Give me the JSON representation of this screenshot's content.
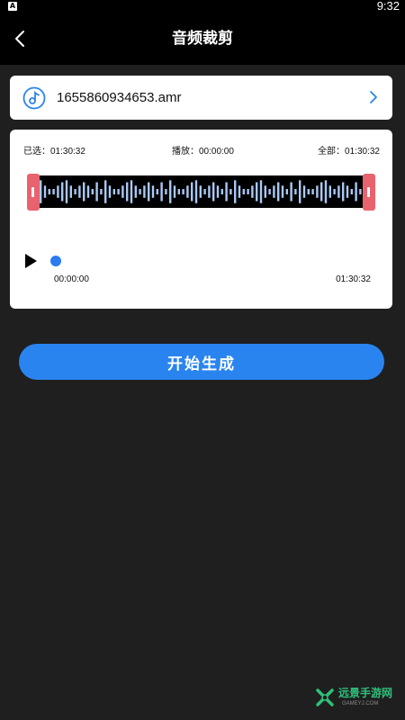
{
  "status_bar": {
    "badge": "A",
    "time": "9:32"
  },
  "app_bar": {
    "title": "音频裁剪",
    "back_icon": "back-arrow-icon"
  },
  "file": {
    "name": "1655860934653.amr",
    "icon": "music-note-icon",
    "chevron_icon": "chevron-right-icon"
  },
  "editor": {
    "selected": "已选：01:30:32",
    "playing": "播放：00:00:00",
    "total": "全部：01:30:32",
    "time_start": "00:00:00",
    "time_end": "01:30:32",
    "playback_progress": 0
  },
  "actions": {
    "generate_label": "开始生成"
  },
  "watermark": {
    "brand": "远景手游网",
    "sub": "GAMEYJ.COM"
  },
  "colors": {
    "accent": "#2a84ef",
    "handle": "#e8636e",
    "wave": "#a9c9f5",
    "knob": "#2a7cf0",
    "brand_green": "#2fc07a"
  }
}
